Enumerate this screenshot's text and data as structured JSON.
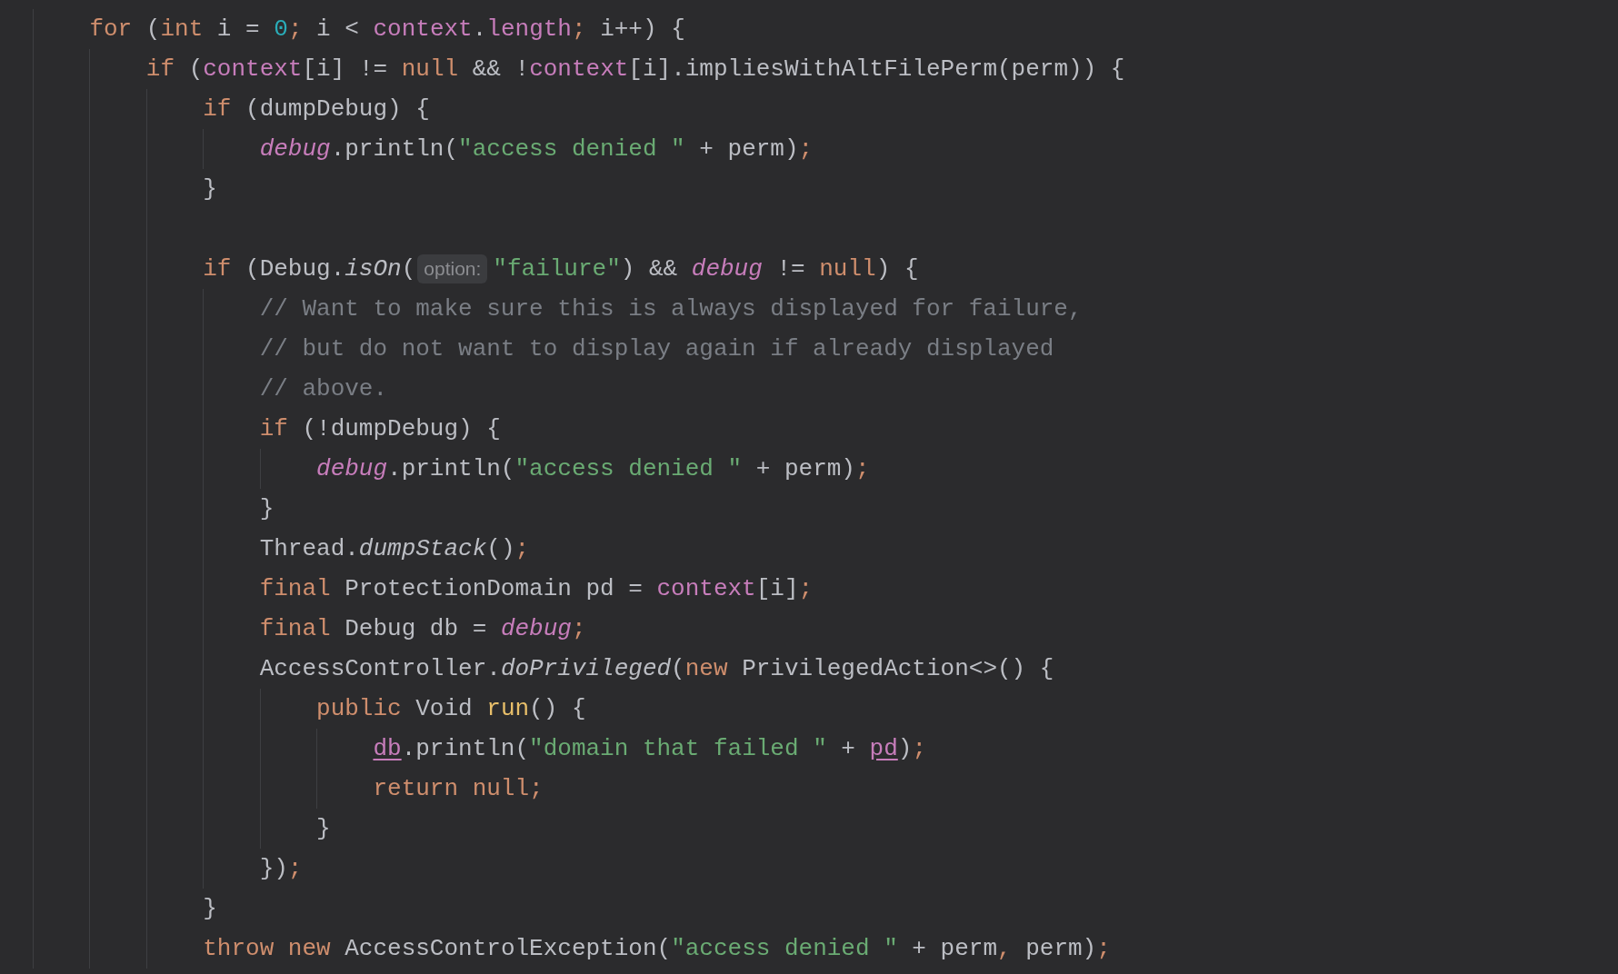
{
  "editor": {
    "lines": [
      {
        "kind": "code",
        "tokens": [
          {
            "kind": "keyword",
            "text": "for"
          },
          {
            "kind": "plain",
            "text": " ("
          },
          {
            "kind": "keyword",
            "text": "int"
          },
          {
            "kind": "plain",
            "text": " i = "
          },
          {
            "kind": "number",
            "text": "0"
          },
          {
            "kind": "punct",
            "text": ";"
          },
          {
            "kind": "plain",
            "text": " i < "
          },
          {
            "kind": "field",
            "text": "context"
          },
          {
            "kind": "plain",
            "text": "."
          },
          {
            "kind": "field",
            "text": "length"
          },
          {
            "kind": "punct",
            "text": ";"
          },
          {
            "kind": "plain",
            "text": " i++) {"
          }
        ],
        "children": [
          {
            "kind": "code",
            "tokens": [
              {
                "kind": "keyword",
                "text": "if"
              },
              {
                "kind": "plain",
                "text": " ("
              },
              {
                "kind": "field",
                "text": "context"
              },
              {
                "kind": "plain",
                "text": "[i] != "
              },
              {
                "kind": "keyword",
                "text": "null"
              },
              {
                "kind": "plain",
                "text": " && !"
              },
              {
                "kind": "field",
                "text": "context"
              },
              {
                "kind": "plain",
                "text": "[i].impliesWithAltFilePerm(perm)) {"
              }
            ],
            "children": [
              {
                "kind": "code",
                "tokens": [
                  {
                    "kind": "keyword",
                    "text": "if"
                  },
                  {
                    "kind": "plain",
                    "text": " (dumpDebug) {"
                  }
                ],
                "children": [
                  {
                    "kind": "code",
                    "tokens": [
                      {
                        "kind": "static",
                        "text": "debug"
                      },
                      {
                        "kind": "plain",
                        "text": ".println("
                      },
                      {
                        "kind": "string",
                        "text": "\"access denied \""
                      },
                      {
                        "kind": "plain",
                        "text": " + perm)"
                      },
                      {
                        "kind": "punct",
                        "text": ";"
                      }
                    ]
                  }
                ]
              },
              {
                "kind": "code",
                "tokens": [
                  {
                    "kind": "plain",
                    "text": "}"
                  }
                ]
              },
              {
                "kind": "blank"
              },
              {
                "kind": "code",
                "tokens": [
                  {
                    "kind": "keyword",
                    "text": "if"
                  },
                  {
                    "kind": "plain",
                    "text": " (Debug."
                  },
                  {
                    "kind": "call",
                    "text": "isOn"
                  },
                  {
                    "kind": "plain",
                    "text": "("
                  },
                  {
                    "kind": "hint",
                    "text": "option:"
                  },
                  {
                    "kind": "string",
                    "text": "\"failure\""
                  },
                  {
                    "kind": "plain",
                    "text": ") && "
                  },
                  {
                    "kind": "static",
                    "text": "debug"
                  },
                  {
                    "kind": "plain",
                    "text": " != "
                  },
                  {
                    "kind": "keyword",
                    "text": "null"
                  },
                  {
                    "kind": "plain",
                    "text": ") {"
                  }
                ],
                "children": [
                  {
                    "kind": "code",
                    "tokens": [
                      {
                        "kind": "comment",
                        "text": "// Want to make sure this is always displayed for failure,"
                      }
                    ]
                  },
                  {
                    "kind": "code",
                    "tokens": [
                      {
                        "kind": "comment",
                        "text": "// but do not want to display again if already displayed"
                      }
                    ]
                  },
                  {
                    "kind": "code",
                    "tokens": [
                      {
                        "kind": "comment",
                        "text": "// above."
                      }
                    ]
                  },
                  {
                    "kind": "code",
                    "tokens": [
                      {
                        "kind": "keyword",
                        "text": "if"
                      },
                      {
                        "kind": "plain",
                        "text": " (!dumpDebug) {"
                      }
                    ],
                    "children": [
                      {
                        "kind": "code",
                        "tokens": [
                          {
                            "kind": "static",
                            "text": "debug"
                          },
                          {
                            "kind": "plain",
                            "text": ".println("
                          },
                          {
                            "kind": "string",
                            "text": "\"access denied \""
                          },
                          {
                            "kind": "plain",
                            "text": " + perm)"
                          },
                          {
                            "kind": "punct",
                            "text": ";"
                          }
                        ]
                      }
                    ]
                  },
                  {
                    "kind": "code",
                    "tokens": [
                      {
                        "kind": "plain",
                        "text": "}"
                      }
                    ]
                  },
                  {
                    "kind": "code",
                    "tokens": [
                      {
                        "kind": "plain",
                        "text": "Thread."
                      },
                      {
                        "kind": "call",
                        "text": "dumpStack"
                      },
                      {
                        "kind": "plain",
                        "text": "()"
                      },
                      {
                        "kind": "punct",
                        "text": ";"
                      }
                    ]
                  },
                  {
                    "kind": "code",
                    "tokens": [
                      {
                        "kind": "keyword",
                        "text": "final"
                      },
                      {
                        "kind": "plain",
                        "text": " ProtectionDomain pd = "
                      },
                      {
                        "kind": "field",
                        "text": "context"
                      },
                      {
                        "kind": "plain",
                        "text": "[i]"
                      },
                      {
                        "kind": "punct",
                        "text": ";"
                      }
                    ]
                  },
                  {
                    "kind": "code",
                    "tokens": [
                      {
                        "kind": "keyword",
                        "text": "final"
                      },
                      {
                        "kind": "plain",
                        "text": " Debug db = "
                      },
                      {
                        "kind": "static",
                        "text": "debug"
                      },
                      {
                        "kind": "punct",
                        "text": ";"
                      }
                    ]
                  },
                  {
                    "kind": "code",
                    "tokens": [
                      {
                        "kind": "plain",
                        "text": "AccessController."
                      },
                      {
                        "kind": "call",
                        "text": "doPrivileged"
                      },
                      {
                        "kind": "plain",
                        "text": "("
                      },
                      {
                        "kind": "keyword",
                        "text": "new"
                      },
                      {
                        "kind": "plain",
                        "text": " PrivilegedAction<>() {"
                      }
                    ],
                    "children": [
                      {
                        "kind": "code",
                        "tokens": [
                          {
                            "kind": "keyword",
                            "text": "public"
                          },
                          {
                            "kind": "plain",
                            "text": " Void "
                          },
                          {
                            "kind": "decl",
                            "text": "run"
                          },
                          {
                            "kind": "plain",
                            "text": "() {"
                          }
                        ],
                        "children": [
                          {
                            "kind": "code",
                            "tokens": [
                              {
                                "kind": "captured",
                                "text": "db"
                              },
                              {
                                "kind": "plain",
                                "text": ".println("
                              },
                              {
                                "kind": "string",
                                "text": "\"domain that failed \""
                              },
                              {
                                "kind": "plain",
                                "text": " + "
                              },
                              {
                                "kind": "captured",
                                "text": "pd"
                              },
                              {
                                "kind": "plain",
                                "text": ")"
                              },
                              {
                                "kind": "punct",
                                "text": ";"
                              }
                            ]
                          },
                          {
                            "kind": "code",
                            "tokens": [
                              {
                                "kind": "keyword",
                                "text": "return null;"
                              }
                            ]
                          }
                        ]
                      },
                      {
                        "kind": "code",
                        "tokens": [
                          {
                            "kind": "plain",
                            "text": "}"
                          }
                        ]
                      }
                    ]
                  },
                  {
                    "kind": "code",
                    "tokens": [
                      {
                        "kind": "plain",
                        "text": "})"
                      },
                      {
                        "kind": "punct",
                        "text": ";"
                      }
                    ]
                  }
                ]
              },
              {
                "kind": "code",
                "tokens": [
                  {
                    "kind": "plain",
                    "text": "}"
                  }
                ]
              },
              {
                "kind": "code",
                "tokens": [
                  {
                    "kind": "keyword",
                    "text": "throw new"
                  },
                  {
                    "kind": "plain",
                    "text": " AccessControlException("
                  },
                  {
                    "kind": "string",
                    "text": "\"access denied \""
                  },
                  {
                    "kind": "plain",
                    "text": " + perm"
                  },
                  {
                    "kind": "punct",
                    "text": ","
                  },
                  {
                    "kind": "plain",
                    "text": " perm)"
                  },
                  {
                    "kind": "punct",
                    "text": ";"
                  }
                ]
              }
            ]
          }
        ]
      }
    ]
  }
}
